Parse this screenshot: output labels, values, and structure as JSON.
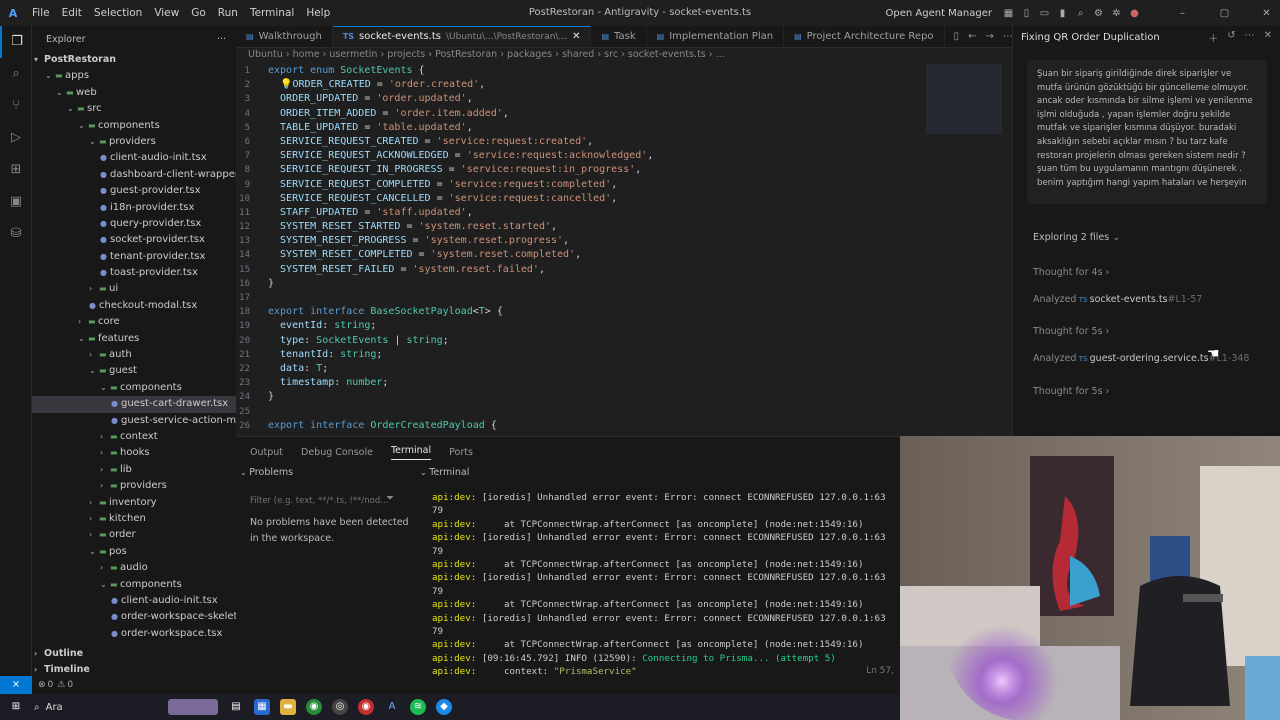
{
  "titlebar": {
    "menu": [
      "File",
      "Edit",
      "Selection",
      "View",
      "Go",
      "Run",
      "Terminal",
      "Help"
    ],
    "window_title": "PostRestoran - Antigravity - socket-events.ts",
    "open_agent_manager": "Open Agent Manager"
  },
  "explorer": {
    "header": "Explorer",
    "root": "PostRestoran",
    "items": [
      {
        "label": "apps",
        "depth": 1,
        "type": "folder"
      },
      {
        "label": "web",
        "depth": 2,
        "type": "folder"
      },
      {
        "label": "src",
        "depth": 3,
        "type": "folder"
      },
      {
        "label": "components",
        "depth": 4,
        "type": "folder"
      },
      {
        "label": "providers",
        "depth": 5,
        "type": "folder"
      },
      {
        "label": "client-audio-init.tsx",
        "depth": 6,
        "type": "file"
      },
      {
        "label": "dashboard-client-wrapper.tsx",
        "depth": 6,
        "type": "file"
      },
      {
        "label": "guest-provider.tsx",
        "depth": 6,
        "type": "file"
      },
      {
        "label": "i18n-provider.tsx",
        "depth": 6,
        "type": "file"
      },
      {
        "label": "query-provider.tsx",
        "depth": 6,
        "type": "file"
      },
      {
        "label": "socket-provider.tsx",
        "depth": 6,
        "type": "file"
      },
      {
        "label": "tenant-provider.tsx",
        "depth": 6,
        "type": "file"
      },
      {
        "label": "toast-provider.tsx",
        "depth": 6,
        "type": "file"
      },
      {
        "label": "ui",
        "depth": 5,
        "type": "folder-closed"
      },
      {
        "label": "checkout-modal.tsx",
        "depth": 5,
        "type": "file"
      },
      {
        "label": "core",
        "depth": 4,
        "type": "folder-closed"
      },
      {
        "label": "features",
        "depth": 4,
        "type": "folder"
      },
      {
        "label": "auth",
        "depth": 5,
        "type": "folder-closed"
      },
      {
        "label": "guest",
        "depth": 5,
        "type": "folder"
      },
      {
        "label": "components",
        "depth": 6,
        "type": "folder"
      },
      {
        "label": "guest-cart-drawer.tsx",
        "depth": 7,
        "type": "file",
        "selected": true
      },
      {
        "label": "guest-service-action-menu.t...",
        "depth": 7,
        "type": "file"
      },
      {
        "label": "context",
        "depth": 6,
        "type": "folder-closed"
      },
      {
        "label": "hooks",
        "depth": 6,
        "type": "folder-closed"
      },
      {
        "label": "lib",
        "depth": 6,
        "type": "folder-closed"
      },
      {
        "label": "providers",
        "depth": 6,
        "type": "folder-closed"
      },
      {
        "label": "inventory",
        "depth": 5,
        "type": "folder-closed"
      },
      {
        "label": "kitchen",
        "depth": 5,
        "type": "folder-closed"
      },
      {
        "label": "order",
        "depth": 5,
        "type": "folder-closed"
      },
      {
        "label": "pos",
        "depth": 5,
        "type": "folder"
      },
      {
        "label": "audio",
        "depth": 6,
        "type": "folder-closed"
      },
      {
        "label": "components",
        "depth": 6,
        "type": "folder"
      },
      {
        "label": "client-audio-init.tsx",
        "depth": 7,
        "type": "file"
      },
      {
        "label": "order-workspace-skeleton.tsx",
        "depth": 7,
        "type": "file"
      },
      {
        "label": "order-workspace.tsx",
        "depth": 7,
        "type": "file"
      }
    ],
    "outline": "Outline",
    "timeline": "Timeline"
  },
  "tabs": [
    {
      "label": "Walkthrough",
      "active": false
    },
    {
      "label": "socket-events.ts",
      "suffix": "\\Ubuntu\\...\\PostRestoran\\...",
      "active": true
    },
    {
      "label": "Task",
      "active": false
    },
    {
      "label": "Implementation Plan",
      "active": false
    },
    {
      "label": "Project Architecture Repo",
      "active": false
    }
  ],
  "breadcrumb": [
    "Ubuntu",
    "home",
    "usermetin",
    "projects",
    "PostRestoran",
    "packages",
    "shared",
    "src",
    "socket-events.ts",
    "..."
  ],
  "code": [
    {
      "n": "1",
      "parts": [
        [
          "kw",
          "export "
        ],
        [
          "kw",
          "enum "
        ],
        [
          "ty",
          "SocketEvents "
        ],
        [
          "pu",
          "{"
        ]
      ]
    },
    {
      "n": "2",
      "parts": [
        [
          "pu",
          "  💡"
        ],
        [
          "ct",
          "ORDER_CREATED "
        ],
        [
          "pu",
          "= "
        ],
        [
          "st",
          "'order.created'"
        ],
        [
          "pu",
          ","
        ]
      ]
    },
    {
      "n": "3",
      "parts": [
        [
          "ct",
          "  ORDER_UPDATED "
        ],
        [
          "pu",
          "= "
        ],
        [
          "st",
          "'order.updated'"
        ],
        [
          "pu",
          ","
        ]
      ]
    },
    {
      "n": "4",
      "parts": [
        [
          "ct",
          "  ORDER_ITEM_ADDED "
        ],
        [
          "pu",
          "= "
        ],
        [
          "st",
          "'order.item.added'"
        ],
        [
          "pu",
          ","
        ]
      ]
    },
    {
      "n": "5",
      "parts": [
        [
          "ct",
          "  TABLE_UPDATED "
        ],
        [
          "pu",
          "= "
        ],
        [
          "st",
          "'table.updated'"
        ],
        [
          "pu",
          ","
        ]
      ]
    },
    {
      "n": "6",
      "parts": [
        [
          "ct",
          "  SERVICE_REQUEST_CREATED "
        ],
        [
          "pu",
          "= "
        ],
        [
          "st",
          "'service:request:created'"
        ],
        [
          "pu",
          ","
        ]
      ]
    },
    {
      "n": "7",
      "parts": [
        [
          "ct",
          "  SERVICE_REQUEST_ACKNOWLEDGED "
        ],
        [
          "pu",
          "= "
        ],
        [
          "st",
          "'service:request:acknowledged'"
        ],
        [
          "pu",
          ","
        ]
      ]
    },
    {
      "n": "8",
      "parts": [
        [
          "ct",
          "  SERVICE_REQUEST_IN_PROGRESS "
        ],
        [
          "pu",
          "= "
        ],
        [
          "st",
          "'service:request:in_progress'"
        ],
        [
          "pu",
          ","
        ]
      ]
    },
    {
      "n": "9",
      "parts": [
        [
          "ct",
          "  SERVICE_REQUEST_COMPLETED "
        ],
        [
          "pu",
          "= "
        ],
        [
          "st",
          "'service:request:completed'"
        ],
        [
          "pu",
          ","
        ]
      ]
    },
    {
      "n": "10",
      "parts": [
        [
          "ct",
          "  SERVICE_REQUEST_CANCELLED "
        ],
        [
          "pu",
          "= "
        ],
        [
          "st",
          "'service:request:cancelled'"
        ],
        [
          "pu",
          ","
        ]
      ]
    },
    {
      "n": "11",
      "parts": [
        [
          "ct",
          "  STAFF_UPDATED "
        ],
        [
          "pu",
          "= "
        ],
        [
          "st",
          "'staff.updated'"
        ],
        [
          "pu",
          ","
        ]
      ]
    },
    {
      "n": "12",
      "parts": [
        [
          "ct",
          "  SYSTEM_RESET_STARTED "
        ],
        [
          "pu",
          "= "
        ],
        [
          "st",
          "'system.reset.started'"
        ],
        [
          "pu",
          ","
        ]
      ]
    },
    {
      "n": "13",
      "parts": [
        [
          "ct",
          "  SYSTEM_RESET_PROGRESS "
        ],
        [
          "pu",
          "= "
        ],
        [
          "st",
          "'system.reset.progress'"
        ],
        [
          "pu",
          ","
        ]
      ]
    },
    {
      "n": "14",
      "parts": [
        [
          "ct",
          "  SYSTEM_RESET_COMPLETED "
        ],
        [
          "pu",
          "= "
        ],
        [
          "st",
          "'system.reset.completed'"
        ],
        [
          "pu",
          ","
        ]
      ]
    },
    {
      "n": "15",
      "parts": [
        [
          "ct",
          "  SYSTEM_RESET_FAILED "
        ],
        [
          "pu",
          "= "
        ],
        [
          "st",
          "'system.reset.failed'"
        ],
        [
          "pu",
          ","
        ]
      ]
    },
    {
      "n": "16",
      "parts": [
        [
          "pu",
          "}"
        ]
      ]
    },
    {
      "n": "17",
      "parts": []
    },
    {
      "n": "18",
      "parts": [
        [
          "kw",
          "export "
        ],
        [
          "kw",
          "interface "
        ],
        [
          "ty",
          "BaseSocketPayload"
        ],
        [
          "pu",
          "<"
        ],
        [
          "ty",
          "T"
        ],
        [
          "pu",
          "> {"
        ]
      ]
    },
    {
      "n": "19",
      "parts": [
        [
          "ct",
          "  eventId"
        ],
        [
          "pu",
          ": "
        ],
        [
          "ty",
          "string"
        ],
        [
          "pu",
          ";"
        ]
      ]
    },
    {
      "n": "20",
      "parts": [
        [
          "ct",
          "  type"
        ],
        [
          "pu",
          ": "
        ],
        [
          "ty",
          "SocketEvents "
        ],
        [
          "pu",
          "| "
        ],
        [
          "ty",
          "string"
        ],
        [
          "pu",
          ";"
        ]
      ]
    },
    {
      "n": "21",
      "parts": [
        [
          "ct",
          "  tenantId"
        ],
        [
          "pu",
          ": "
        ],
        [
          "ty",
          "string"
        ],
        [
          "pu",
          ";"
        ]
      ]
    },
    {
      "n": "22",
      "parts": [
        [
          "ct",
          "  data"
        ],
        [
          "pu",
          ": "
        ],
        [
          "ty",
          "T"
        ],
        [
          "pu",
          ";"
        ]
      ]
    },
    {
      "n": "23",
      "parts": [
        [
          "ct",
          "  timestamp"
        ],
        [
          "pu",
          ": "
        ],
        [
          "ty",
          "number"
        ],
        [
          "pu",
          ";"
        ]
      ]
    },
    {
      "n": "24",
      "parts": [
        [
          "pu",
          "}"
        ]
      ]
    },
    {
      "n": "25",
      "parts": []
    },
    {
      "n": "26",
      "parts": [
        [
          "kw",
          "export "
        ],
        [
          "kw",
          "interface "
        ],
        [
          "ty",
          "OrderCreatedPayload "
        ],
        [
          "pu",
          "{"
        ]
      ]
    }
  ],
  "panel": {
    "tabs": [
      "Output",
      "Debug Console",
      "Terminal",
      "Ports"
    ],
    "active_tab": "Terminal",
    "problems_header": "Problems",
    "terminal_header": "Terminal",
    "filter_placeholder": "Filter (e.g. text, **/*.ts, !**/nod...",
    "no_problems": "No problems have been detected in the workspace.",
    "line_info": "Ln 57,",
    "terminal_lines": [
      {
        "kind": "err",
        "text": "[ioredis] Unhandled error event: Error: connect ECONNREFUSED 127.0.0.1:63"
      },
      {
        "kind": "cont",
        "text": "79"
      },
      {
        "kind": "at",
        "text": "    at TCPConnectWrap.afterConnect [as oncomplete] (node:net:1549:16)"
      },
      {
        "kind": "err",
        "text": "[ioredis] Unhandled error event: Error: connect ECONNREFUSED 127.0.0.1:63"
      },
      {
        "kind": "cont",
        "text": "79"
      },
      {
        "kind": "at",
        "text": "    at TCPConnectWrap.afterConnect [as oncomplete] (node:net:1549:16)"
      },
      {
        "kind": "err",
        "text": "[ioredis] Unhandled error event: Error: connect ECONNREFUSED 127.0.0.1:63"
      },
      {
        "kind": "cont",
        "text": "79"
      },
      {
        "kind": "at",
        "text": "    at TCPConnectWrap.afterConnect [as oncomplete] (node:net:1549:16)"
      },
      {
        "kind": "err",
        "text": "[ioredis] Unhandled error event: Error: connect ECONNREFUSED 127.0.0.1:63"
      },
      {
        "kind": "cont",
        "text": "79"
      },
      {
        "kind": "at",
        "text": "    at TCPConnectWrap.afterConnect [as oncomplete] (node:net:1549:16)"
      },
      {
        "kind": "info",
        "text": "[09:16:45.792] INFO (12590): ",
        "tail": "Connecting to Prisma... (attempt 5)"
      },
      {
        "kind": "ctx",
        "text": "    context: ",
        "tail": "\"PrismaService\""
      }
    ],
    "api_prefix": "api:dev:"
  },
  "agent": {
    "title": "Fixing QR Order Duplication",
    "message": "Şuan bir sipariş girildiğinde direk siparişler ve mutfa  ürünün gözüktüğü bir güncelleme olmuyor. ancak   oder kısmında bir silme işlemi ve yenilenme işlmi olduğuda  , yapan işlemler doğru şekilde  mutfak  ve siparişler kısmına düşüyor. buradaki aksaklığın sebebi açıklar mısın ?  bu tarz  kafe restoran projelerin olması gereken sistem nedir ?   şuan tüm bu uygulamanın mantıgnı düşünerek . benim yaptığım hangi yapım hataları ve herşeyin",
    "exploring": "Exploring 2 files",
    "steps": [
      {
        "label": "Thought for 4s"
      },
      {
        "label": "Analyzed",
        "file": "socket-events.ts",
        "range": "#L1-57"
      },
      {
        "label": "Thought for 5s"
      },
      {
        "label": "Analyzed",
        "file": "guest-ordering.service.ts",
        "range": "#L1-348"
      },
      {
        "label": "Thought for 5s"
      }
    ]
  },
  "statusbar": {
    "errors": "0",
    "warnings": "0"
  },
  "taskbar": {
    "search_label": "Ara"
  }
}
